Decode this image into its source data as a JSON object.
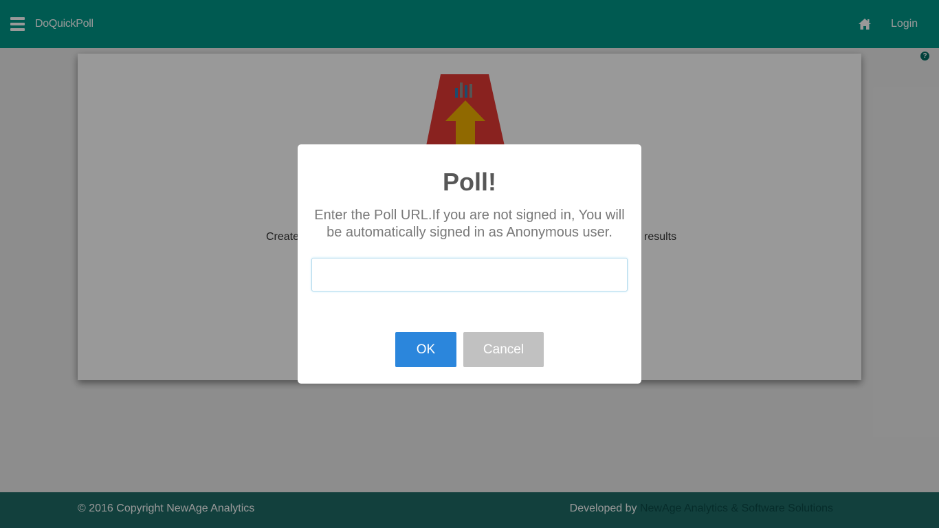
{
  "navbar": {
    "brand": "DoQuickPoll",
    "login": "Login",
    "icons": [
      "menu-icon",
      "home-icon"
    ]
  },
  "help": {
    "glyph": "?"
  },
  "card": {
    "tagline_left": "Create,",
    "tagline_right": "results"
  },
  "footer": {
    "copyright": "© 2016 Copyright NewAge Analytics",
    "developed_by": "Developed by",
    "developer_link": "NewAge Analytics & Software Solutions"
  },
  "modal": {
    "title": "Poll!",
    "text": "Enter the Poll URL.If you are not signed in, You will be automatically signed in as Anonymous user.",
    "input_value": "",
    "ok_label": "OK",
    "cancel_label": "Cancel"
  },
  "colors": {
    "primary": "#009688",
    "footer": "#1e6b67",
    "ok_button": "#2b86dc",
    "cancel_button": "#c1c1c1"
  }
}
